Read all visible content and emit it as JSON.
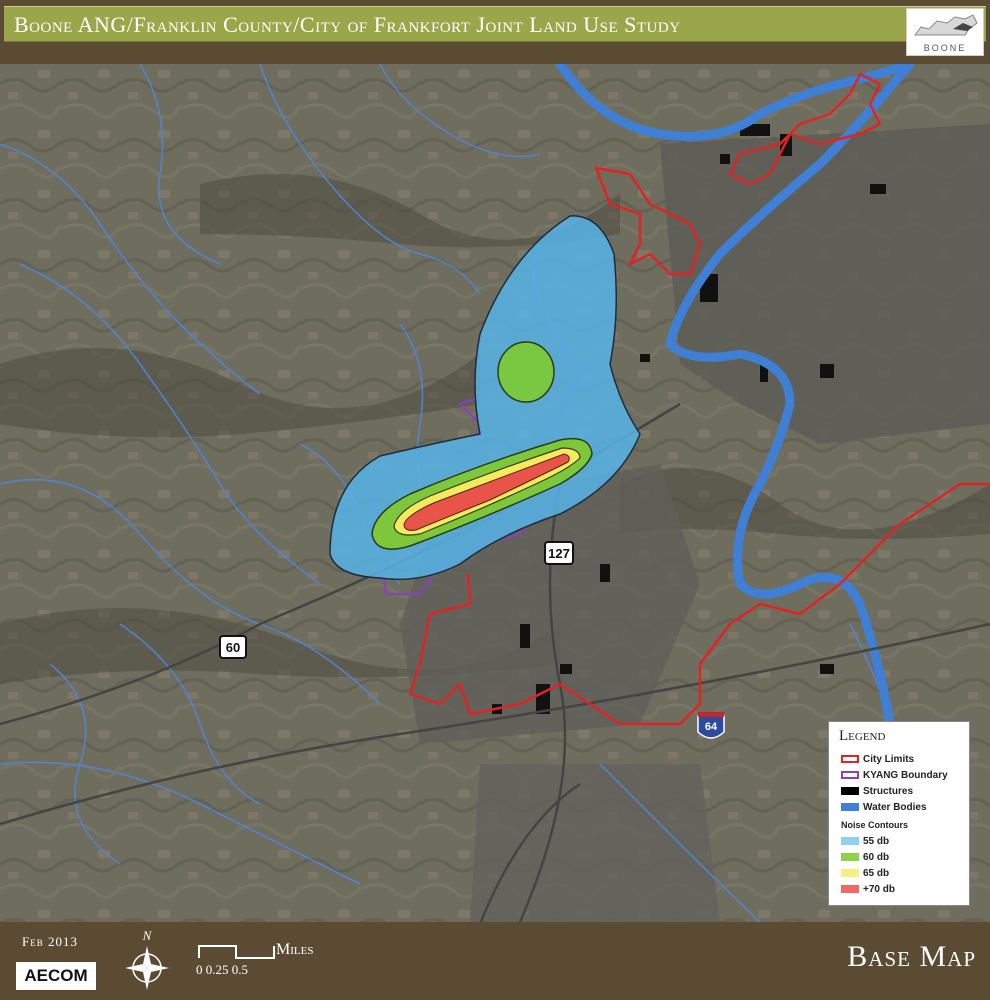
{
  "header": {
    "title": "Boone ANG/Franklin County/City of Frankfort Joint Land Use Study",
    "logo_text": "BOONE"
  },
  "map": {
    "road_labels": {
      "us127": "127",
      "us60": "60",
      "i64": "64"
    },
    "colors": {
      "city_limits": "#e02424",
      "kyang_boundary": "#8a3fc0",
      "structures": "#000000",
      "water": "#3f7fd6",
      "noise_55": "#5ab6e6",
      "noise_60": "#7cc83a",
      "noise_65": "#f3ec5a",
      "noise_70": "#e8534a"
    }
  },
  "legend": {
    "title": "Legend",
    "items": [
      {
        "label": "City Limits",
        "kind": "outline",
        "color": "#e02424"
      },
      {
        "label": "KYANG Boundary",
        "kind": "outline",
        "color": "#8a3fc0"
      },
      {
        "label": "Structures",
        "kind": "fill",
        "color": "#000000"
      },
      {
        "label": "Water Bodies",
        "kind": "fill",
        "color": "#3f7fd6"
      }
    ],
    "noise_title": "Noise Contours",
    "noise_items": [
      {
        "label": "55 db",
        "color": "#8fd0ee"
      },
      {
        "label": "60 db",
        "color": "#8fd24a"
      },
      {
        "label": "65 db",
        "color": "#f5f080"
      },
      {
        "label": "+70 db",
        "color": "#ef6a62"
      }
    ]
  },
  "footer": {
    "date": "Feb 2013",
    "company": "AECOM",
    "north": "N",
    "scale_unit": "Miles",
    "scale_ticks": "0  0.25 0.5",
    "map_name": "Base Map"
  }
}
